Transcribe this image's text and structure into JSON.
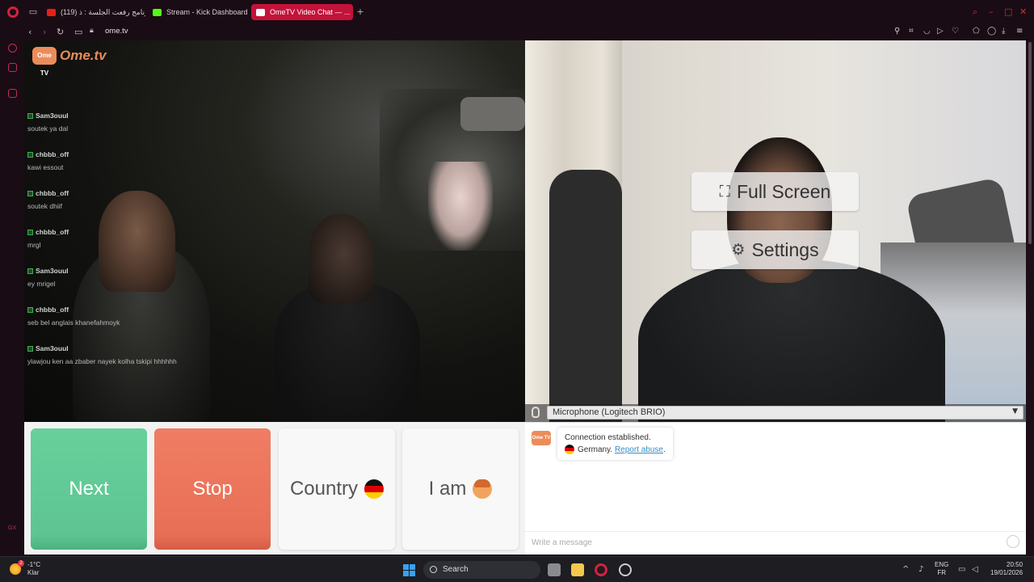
{
  "tabs": [
    {
      "label": "(119) برنامج رفعت الجلسة : ذ..."
    },
    {
      "label": "Stream - Kick Dashboard"
    },
    {
      "label": "OmeTV Video Chat — ..."
    }
  ],
  "address": {
    "url": "ome.tv"
  },
  "logo": {
    "badge": "Ome TV",
    "text": "Ome.tv"
  },
  "chat_overlay": [
    {
      "user": "Sam3ouul",
      "text": "soutek ya dal"
    },
    {
      "user": "chbbb_off",
      "text": "kawi essout"
    },
    {
      "user": "chbbb_off",
      "text": "soutek dhiif"
    },
    {
      "user": "chbbb_off",
      "text": "mrgl"
    },
    {
      "user": "Sam3ouul",
      "text": "ey mrigel"
    },
    {
      "user": "chbbb_off",
      "text": "seb bel anglais khanefahmoyk"
    },
    {
      "user": "Sam3ouul",
      "text": "ylawjou ken aa zbaber nayek kolha tskipi hhhhhh"
    }
  ],
  "overlay": {
    "fullscreen_label": "Full Screen",
    "settings_label": "Settings"
  },
  "microphone": {
    "selected": "Microphone (Logitech BRIO)"
  },
  "controls": {
    "next_label": "Next",
    "stop_label": "Stop",
    "country_label": "Country",
    "iam_label": "I am"
  },
  "chat": {
    "logo": "Ome TV",
    "status": "Connection established.",
    "country": "Germany.",
    "report_label": "Report abuse",
    "period": ".",
    "placeholder": "Write a message"
  },
  "taskbar": {
    "weather_badge": "2",
    "temperature": "-1°C",
    "condition": "Klar",
    "search_label": "Search",
    "lang_top": "ENG",
    "lang_bottom": "FR",
    "time": "20:50",
    "date": "19/01/2026"
  },
  "colors": {
    "next": "#5ec592",
    "stop": "#e86f56",
    "brand": "#ea8c5a",
    "opera_tab": "#c4123a"
  }
}
